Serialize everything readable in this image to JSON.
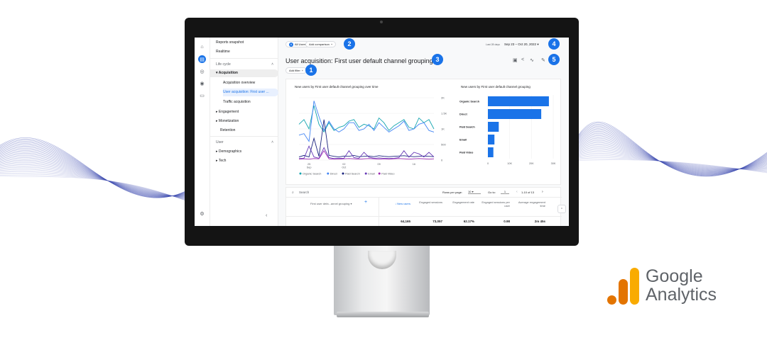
{
  "brand": {
    "logo_text_line1": "Google",
    "logo_text_line2": "Analytics",
    "colors": {
      "orange_dark": "#e37400",
      "orange_light": "#f9ab00",
      "wave": "#3d4bb0"
    }
  },
  "rail": {
    "icons": [
      "home-icon",
      "reports-icon",
      "explore-icon",
      "advertising-icon",
      "library-icon",
      "settings-icon"
    ]
  },
  "nav": {
    "reports_snapshot": "Reports snapshot",
    "realtime": "Realtime",
    "lifecycle_label": "Life cycle",
    "acquisition": "Acquisition",
    "acquisition_overview": "Acquisition overview",
    "user_acquisition": "User acquisition: First user ...",
    "traffic_acquisition": "Traffic acquisition",
    "engagement": "Engagement",
    "monetization": "Monetization",
    "retention": "Retention",
    "user_label": "User",
    "demographics": "Demographics",
    "tech": "Tech",
    "collapse_icon": "chevron-left-icon"
  },
  "header": {
    "segment_letter": "A",
    "segment_label": "All Users",
    "add_comparison": "Add comparison",
    "date_prefix": "Last 28 days",
    "date_range": "Sep 23 – Oct 20, 2022",
    "page_title": "User acquisition: First user default channel grouping",
    "add_filter": "Add filter"
  },
  "badges": [
    "1",
    "2",
    "3",
    "4",
    "5"
  ],
  "line_chart": {
    "title": "New users by First user default channel grouping over time",
    "yticks": [
      "2K",
      "1.5K",
      "1K",
      "500",
      "0"
    ],
    "xticks": [
      [
        "25",
        "Sep"
      ],
      [
        "02",
        "Oct"
      ],
      [
        "09",
        ""
      ],
      [
        "16",
        ""
      ]
    ],
    "legend": [
      "Organic Search",
      "Direct",
      "Paid Search",
      "Email",
      "Paid Video"
    ]
  },
  "bar_chart": {
    "title": "New users by First user default channel grouping",
    "xticks": [
      "0",
      "10K",
      "20K",
      "30K"
    ]
  },
  "chart_data": [
    {
      "type": "line",
      "title": "New users by First user default channel grouping over time",
      "x": [
        "Sep 23",
        "Sep 24",
        "Sep 25",
        "Sep 26",
        "Sep 27",
        "Sep 28",
        "Sep 29",
        "Sep 30",
        "Oct 01",
        "Oct 02",
        "Oct 03",
        "Oct 04",
        "Oct 05",
        "Oct 06",
        "Oct 07",
        "Oct 08",
        "Oct 09",
        "Oct 10",
        "Oct 11",
        "Oct 12",
        "Oct 13",
        "Oct 14",
        "Oct 15",
        "Oct 16",
        "Oct 17",
        "Oct 18",
        "Oct 19",
        "Oct 20"
      ],
      "ylim": [
        0,
        2000
      ],
      "series": [
        {
          "name": "Organic Search",
          "color": "#12a4af",
          "values": [
            1150,
            1300,
            1000,
            1750,
            1150,
            900,
            1200,
            950,
            1050,
            1100,
            1250,
            1300,
            1050,
            1150,
            1100,
            1000,
            1350,
            1200,
            950,
            1100,
            1200,
            1300,
            1050,
            1000,
            1350,
            1200,
            1300,
            1000
          ]
        },
        {
          "name": "Direct",
          "color": "#4285f4",
          "values": [
            800,
            850,
            600,
            1900,
            1400,
            950,
            1250,
            1000,
            900,
            1000,
            1200,
            1200,
            950,
            1000,
            1150,
            950,
            1200,
            1050,
            900,
            1000,
            1100,
            1250,
            950,
            1000,
            1150,
            1200,
            950,
            900
          ]
        },
        {
          "name": "Paid Search",
          "color": "#1a237e",
          "values": [
            100,
            150,
            100,
            700,
            120,
            1300,
            150,
            120,
            100,
            130,
            120,
            150,
            110,
            120,
            130,
            110,
            140,
            120,
            110,
            120,
            130,
            140,
            120,
            110,
            120,
            130,
            120,
            110
          ]
        },
        {
          "name": "Email",
          "color": "#673ab7",
          "values": [
            50,
            60,
            450,
            100,
            60,
            400,
            80,
            50,
            60,
            60,
            300,
            80,
            60,
            250,
            90,
            60,
            70,
            60,
            50,
            60,
            80,
            300,
            90,
            250,
            200,
            100,
            250,
            100
          ]
        },
        {
          "name": "Paid Video",
          "color": "#9c27b0",
          "values": [
            30,
            40,
            30,
            50,
            40,
            300,
            40,
            30,
            30,
            40,
            50,
            40,
            30,
            40,
            50,
            40,
            30,
            40,
            30,
            40,
            50,
            40,
            30,
            40,
            50,
            40,
            30,
            40
          ]
        }
      ]
    },
    {
      "type": "bar",
      "title": "New users by First user default channel grouping",
      "categories": [
        "Organic Search",
        "Direct",
        "Paid Search",
        "Email",
        "Paid Video"
      ],
      "values": [
        28000,
        24500,
        5000,
        3000,
        2500
      ],
      "xlim": [
        0,
        30000
      ]
    }
  ],
  "table": {
    "search_placeholder": "Search",
    "rows_per_page_label": "Rows per page:",
    "rows_per_page": "10",
    "goto_label": "Go to:",
    "goto_value": "1",
    "pagination": "1-10 of 13",
    "dimension_label": "First user defa...annel grouping",
    "columns": [
      {
        "label": "↓ New users",
        "total": "64,165"
      },
      {
        "label": "Engaged sessions",
        "total": "73,057"
      },
      {
        "label": "Engagement rate",
        "total": "62.17%"
      },
      {
        "label": "Engaged sessions per user",
        "total": "0.98"
      },
      {
        "label": "Average engagement time",
        "total": "2m 45s"
      }
    ]
  }
}
